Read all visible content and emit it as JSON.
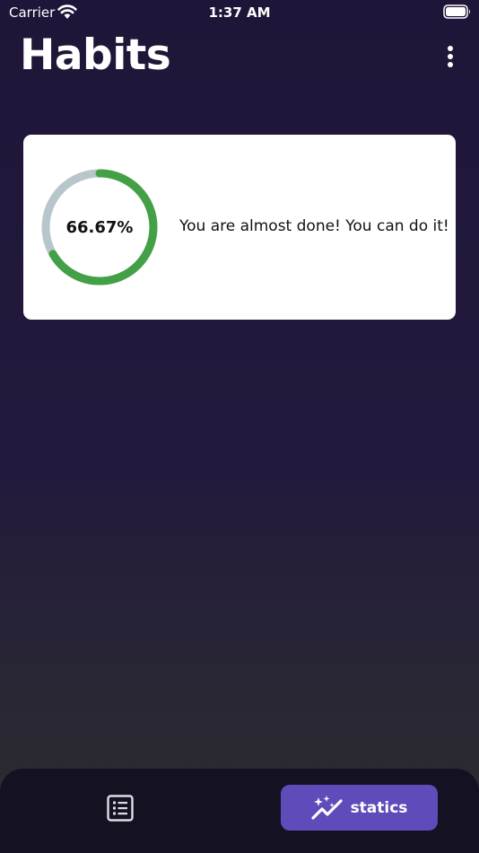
{
  "status_bar": {
    "carrier": "Carrier",
    "time": "1:37 AM"
  },
  "header": {
    "title": "Habits"
  },
  "progress_card": {
    "percent_label": "66.67%",
    "progress": 0.6667,
    "message": "You are almost done! You can do it!",
    "ring_color": "#43a047",
    "track_color": "#b7c6cb"
  },
  "bottom_nav": {
    "tabs": [
      {
        "icon": "list-icon",
        "label": "",
        "active": false
      },
      {
        "icon": "sparkle-chart-icon",
        "label": "statics",
        "active": true
      }
    ],
    "active_color": "#5f4bb9"
  }
}
